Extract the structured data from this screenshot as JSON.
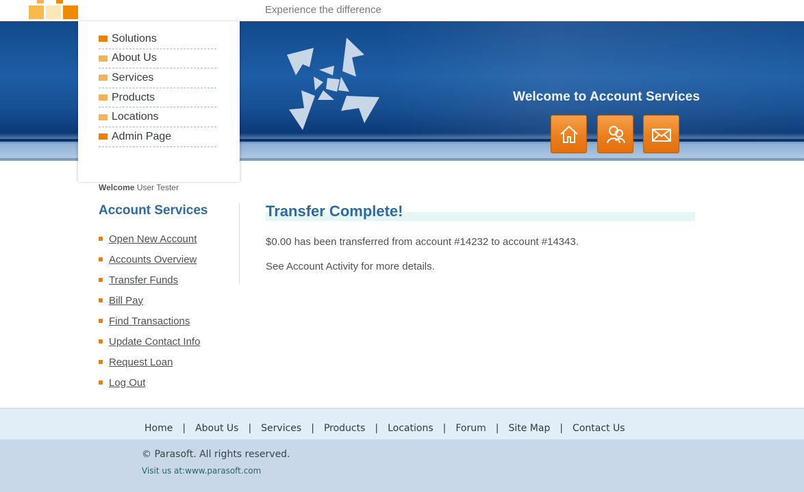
{
  "header": {
    "tagline": "Experience the difference",
    "welcome_title": "Welcome to Account Services",
    "quick_buttons": [
      {
        "icon": "home-icon",
        "label": "home"
      },
      {
        "icon": "about-icon",
        "label": "about"
      },
      {
        "icon": "contact-icon",
        "label": "contact"
      }
    ]
  },
  "top_nav": {
    "items": [
      {
        "label": "Solutions"
      },
      {
        "label": "About Us"
      },
      {
        "label": "Services"
      },
      {
        "label": "Products"
      },
      {
        "label": "Locations"
      },
      {
        "label": "Admin Page"
      }
    ]
  },
  "welcome": {
    "prefix": "Welcome",
    "user": "User Tester"
  },
  "account_services": {
    "heading": "Account Services",
    "items": [
      {
        "label": "Open New Account"
      },
      {
        "label": "Accounts Overview"
      },
      {
        "label": "Transfer Funds"
      },
      {
        "label": "Bill Pay"
      },
      {
        "label": "Find Transactions"
      },
      {
        "label": "Update Contact Info"
      },
      {
        "label": "Request Loan"
      },
      {
        "label": "Log Out"
      }
    ]
  },
  "content": {
    "title": "Transfer Complete!",
    "transfer_message": "$0.00 has been transferred from account #14232 to account #14343.",
    "details_message": "See Account Activity for more details."
  },
  "footer": {
    "links": [
      {
        "label": "Home"
      },
      {
        "label": "About Us"
      },
      {
        "label": "Services"
      },
      {
        "label": "Products"
      },
      {
        "label": "Locations"
      },
      {
        "label": "Forum"
      },
      {
        "label": "Site Map"
      },
      {
        "label": "Contact Us"
      }
    ],
    "separator": "|",
    "copyright": "© Parasoft. All rights reserved.",
    "visit": "Visit us at:www.parasoft.com"
  },
  "colors": {
    "accent_orange": "#ec7f0a",
    "heading_blue": "#2c6aa0",
    "banner_blue": "#1d5ea6"
  }
}
